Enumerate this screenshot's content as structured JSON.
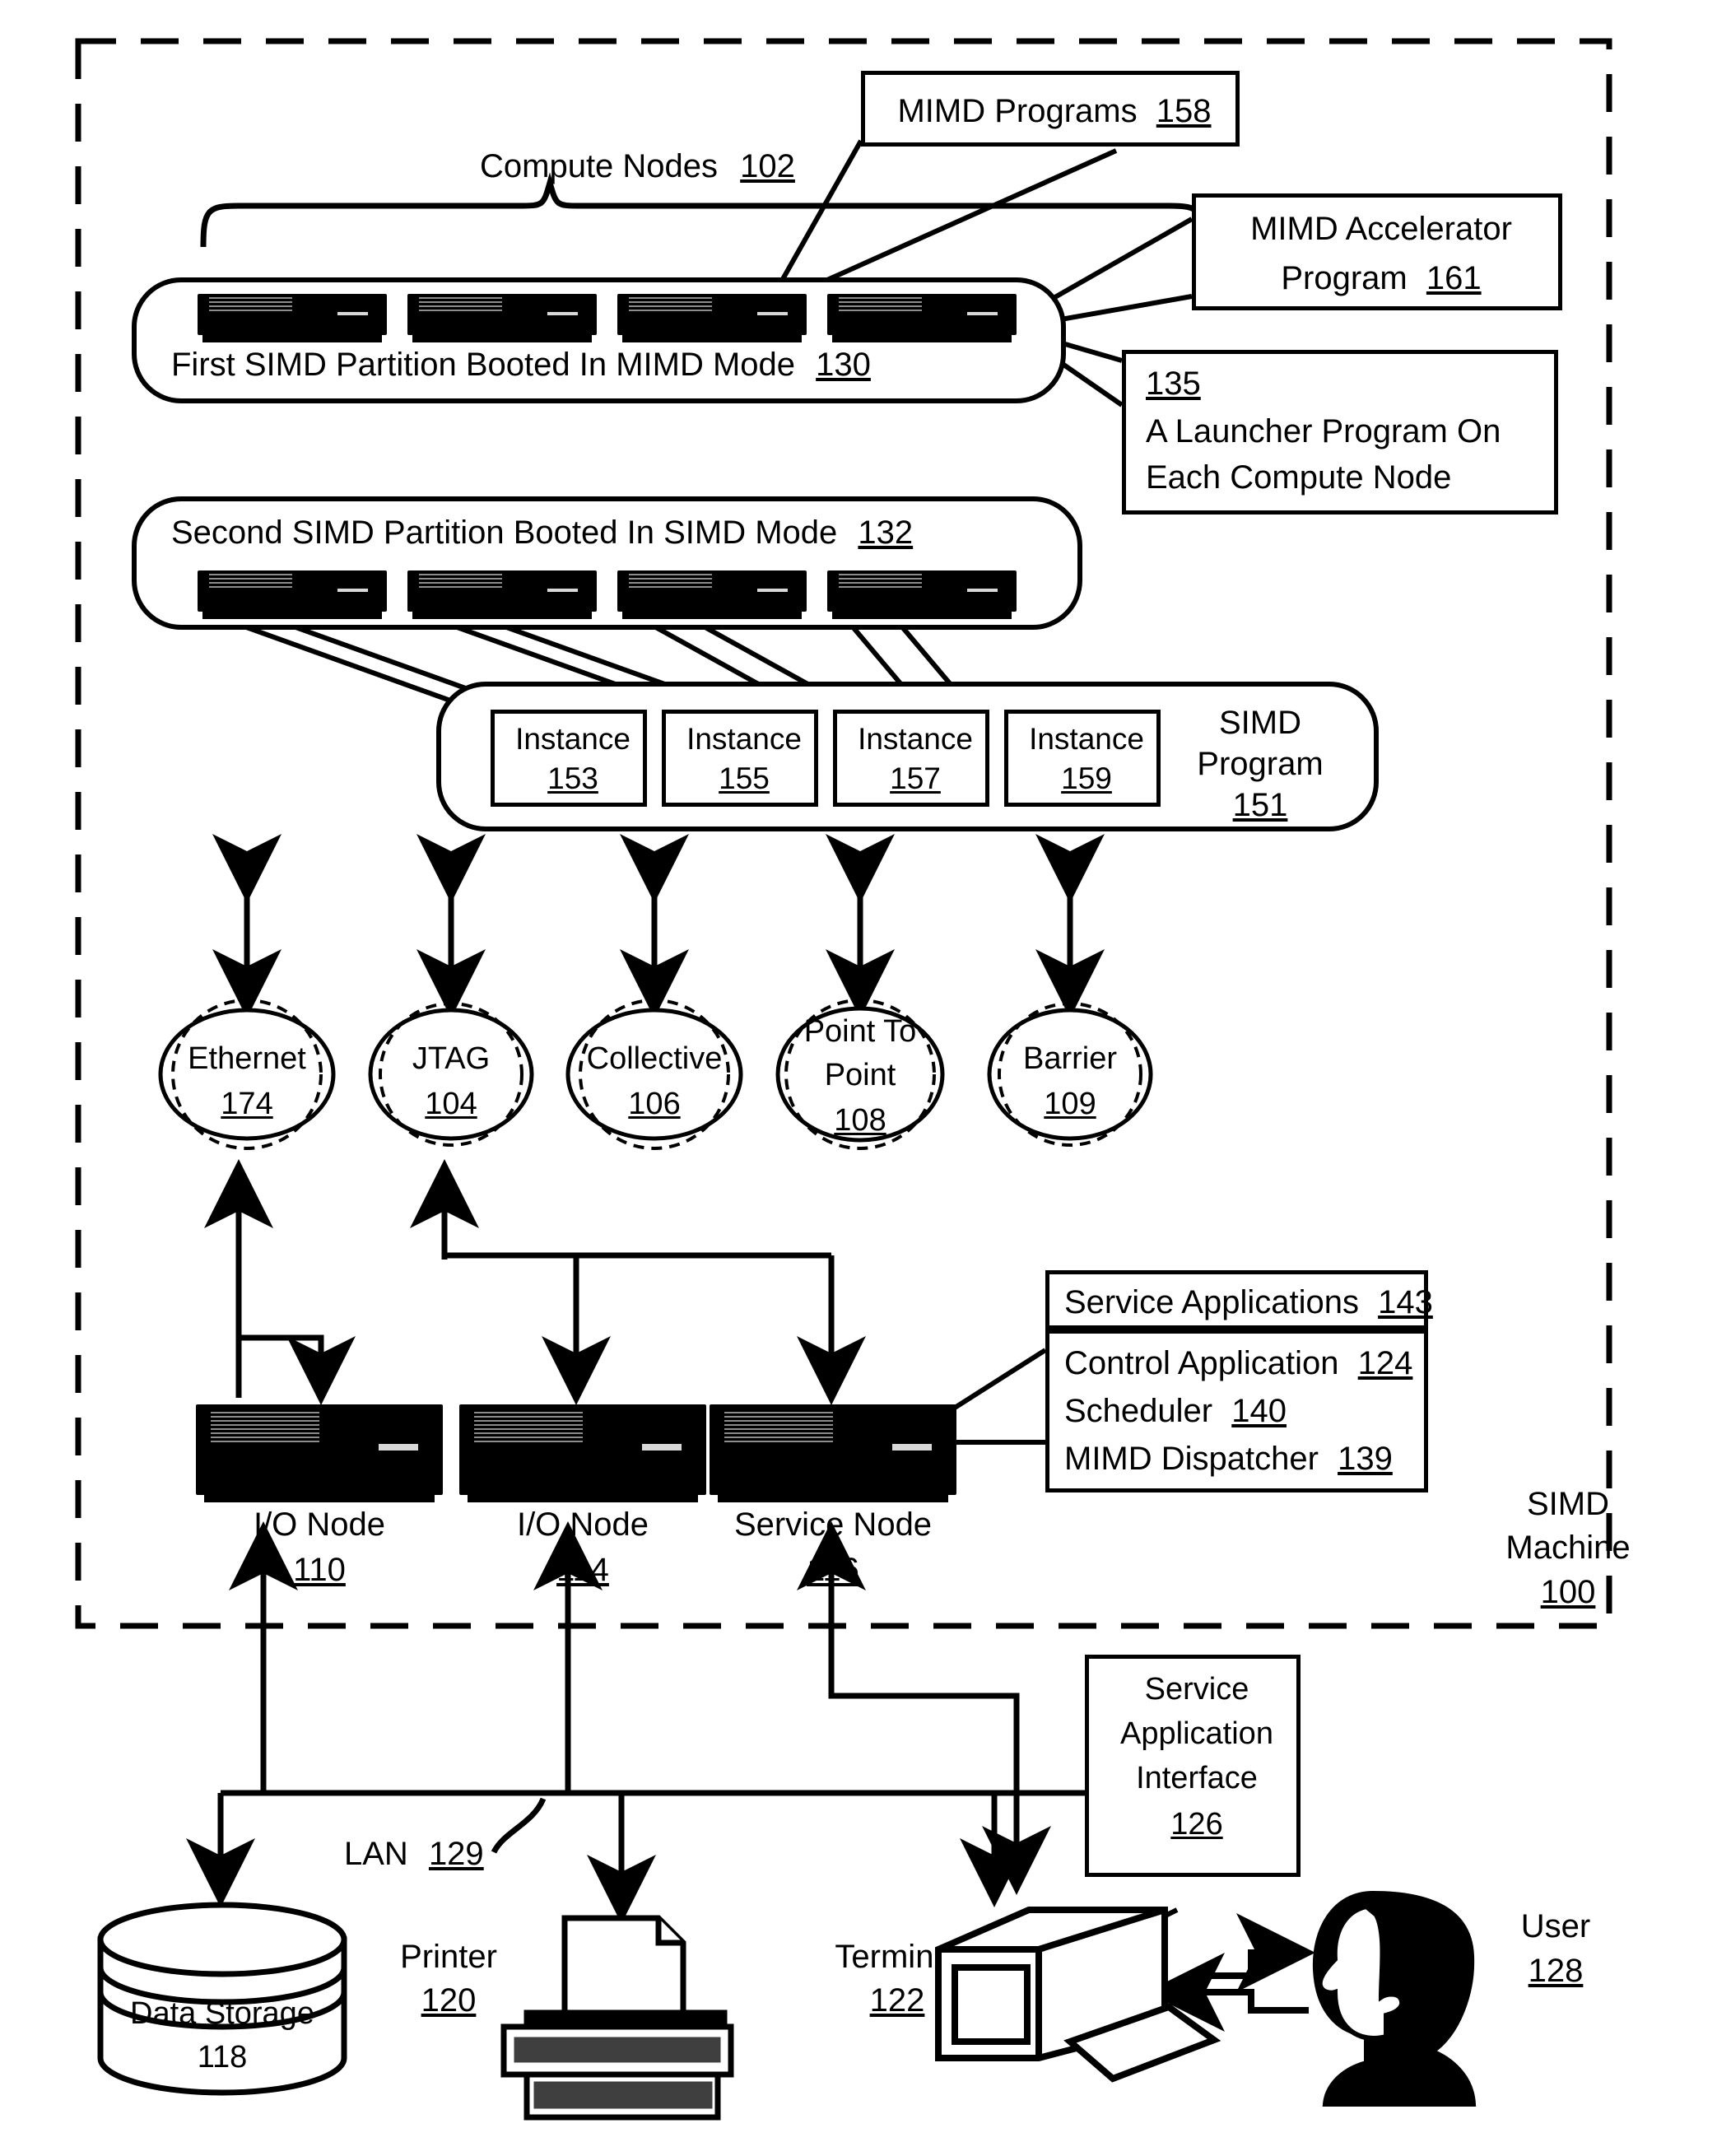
{
  "figure": {
    "machine_label_line1": "SIMD",
    "machine_label_line2": "Machine",
    "machine_label_num": "100"
  },
  "compute_nodes": {
    "label": "Compute Nodes",
    "num": "102"
  },
  "callouts": {
    "mimd_programs": {
      "text": "MIMD Programs",
      "num": "158"
    },
    "mimd_accelerator": {
      "line1": "MIMD Accelerator",
      "line2": "Program",
      "num": "161"
    },
    "launcher": {
      "num": "135",
      "line1": "A Launcher Program On",
      "line2": "Each Compute Node"
    },
    "service_application_interface": {
      "line1": "Service",
      "line2": "Application",
      "line3": "Interface",
      "num": "126"
    }
  },
  "partitions": [
    {
      "label": "First SIMD Partition Booted In MIMD Mode",
      "num": "130",
      "node_count": 4
    },
    {
      "label": "Second SIMD Partition Booted In SIMD Mode",
      "num": "132",
      "node_count": 4
    }
  ],
  "simd_program": {
    "line1": "SIMD",
    "line2": "Program",
    "num": "151",
    "instances": [
      {
        "label": "Instance",
        "num": "153"
      },
      {
        "label": "Instance",
        "num": "155"
      },
      {
        "label": "Instance",
        "num": "157"
      },
      {
        "label": "Instance",
        "num": "159"
      }
    ]
  },
  "networks": [
    {
      "line1": "Ethernet",
      "line2": "",
      "num": "174"
    },
    {
      "line1": "JTAG",
      "line2": "",
      "num": "104"
    },
    {
      "line1": "Collective",
      "line2": "",
      "num": "106"
    },
    {
      "line1": "Point To",
      "line2": "Point",
      "num": "108"
    },
    {
      "line1": "Barrier",
      "line2": "",
      "num": "109"
    }
  ],
  "nodes": [
    {
      "label": "I/O Node",
      "num": "110"
    },
    {
      "label": "I/O Node",
      "num": "114"
    },
    {
      "label": "Service Node",
      "num": "116"
    }
  ],
  "service_applications": {
    "header": "Service Applications",
    "header_num": "143",
    "items": [
      {
        "label": "Control Application",
        "num": "124"
      },
      {
        "label": "Scheduler",
        "num": "140"
      },
      {
        "label": "MIMD Dispatcher",
        "num": "139"
      }
    ]
  },
  "lan": {
    "label": "LAN",
    "num": "129"
  },
  "peripherals": {
    "data_storage": {
      "label": "Data Storage",
      "num": "118"
    },
    "printer": {
      "label": "Printer",
      "num": "120"
    },
    "terminal": {
      "label": "Terminal",
      "num": "122"
    },
    "user": {
      "label": "User",
      "num": "128"
    }
  }
}
